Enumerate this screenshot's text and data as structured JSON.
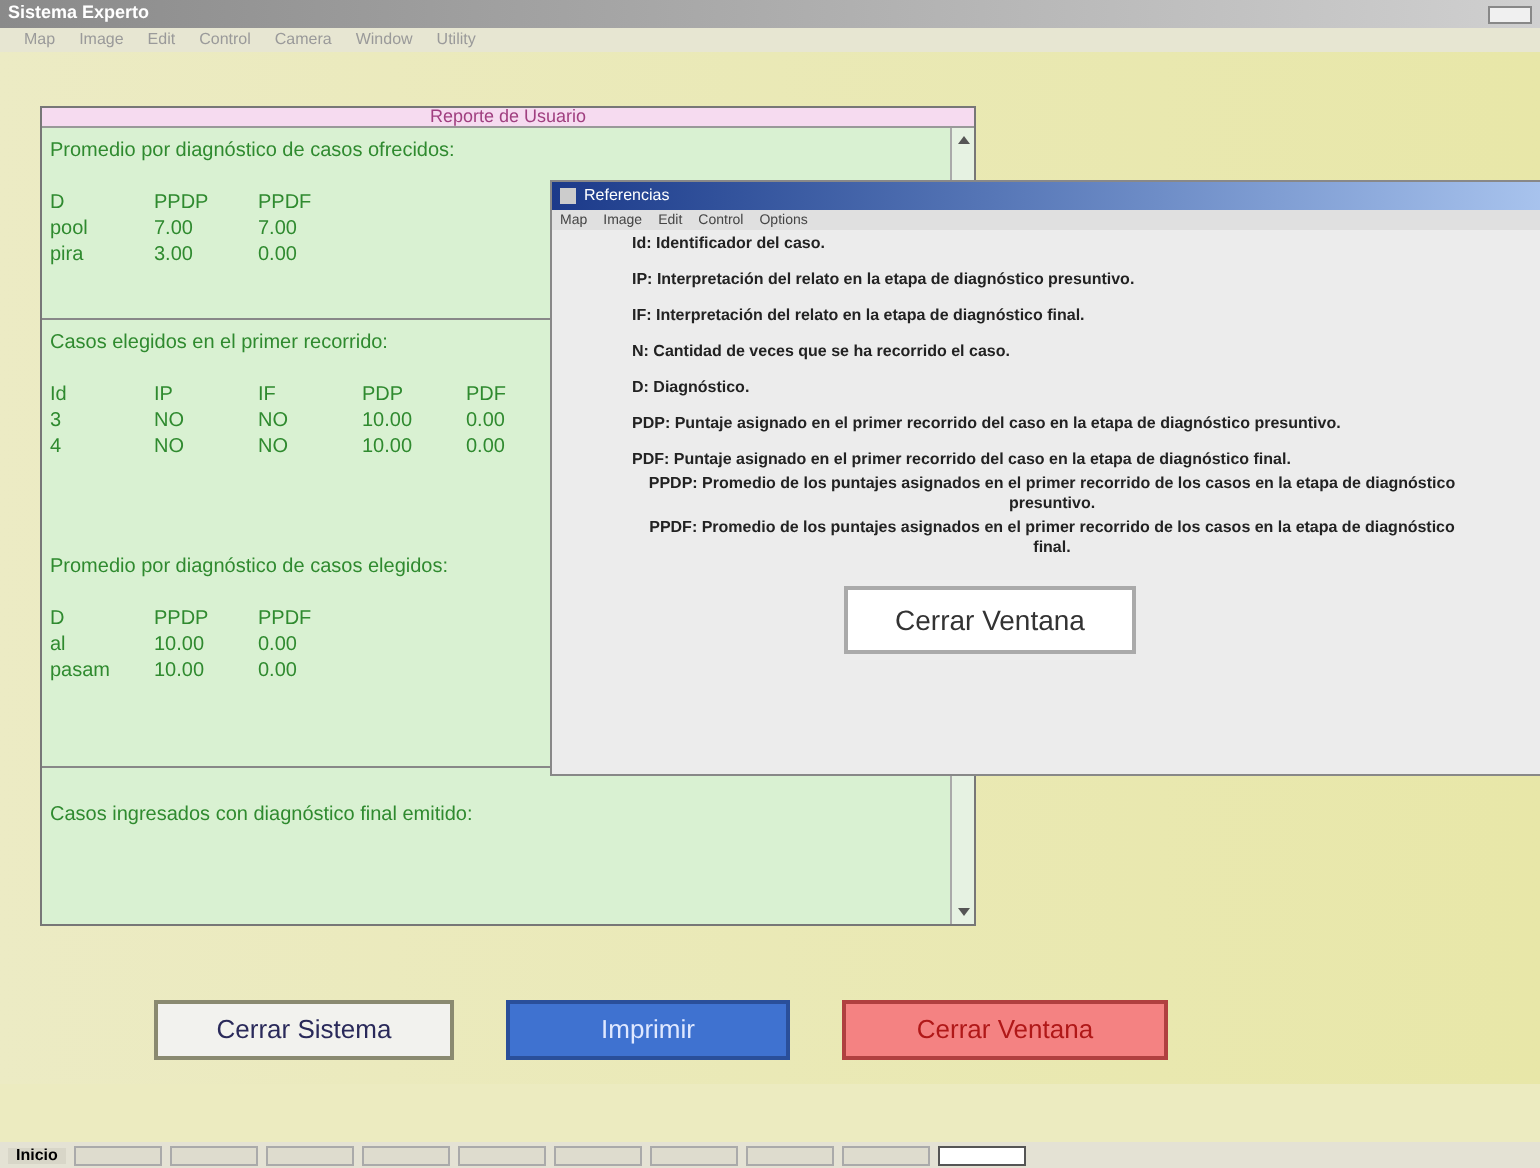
{
  "window": {
    "title": "Sistema Experto",
    "menu": [
      "Map",
      "Image",
      "Edit",
      "Control",
      "Camera",
      "Window",
      "Utility"
    ]
  },
  "report": {
    "title": "Reporte de Usuario",
    "sections": [
      {
        "heading": "Promedio por diagnóstico de casos ofrecidos:",
        "columns": [
          "D",
          "PPDP",
          "PPDF"
        ],
        "rows": [
          [
            "pool",
            "7.00",
            "7.00"
          ],
          [
            "pira",
            "3.00",
            "0.00"
          ]
        ]
      },
      {
        "heading": "Casos elegidos en el primer recorrido:",
        "columns": [
          "Id",
          "IP",
          "IF",
          "PDP",
          "PDF"
        ],
        "rows": [
          [
            "3",
            "NO",
            "NO",
            "10.00",
            "0.00"
          ],
          [
            "4",
            "NO",
            "NO",
            "10.00",
            "0.00"
          ]
        ]
      },
      {
        "heading": "Promedio por diagnóstico de casos elegidos:",
        "columns": [
          "D",
          "PPDP",
          "PPDF"
        ],
        "rows": [
          [
            "al",
            "10.00",
            "0.00"
          ],
          [
            "pasam",
            "10.00",
            "0.00"
          ]
        ]
      },
      {
        "heading": "Casos ingresados con diagnóstico final emitido:"
      }
    ]
  },
  "dialog": {
    "title": "Referencias",
    "menu": [
      "Map",
      "Image",
      "Edit",
      "Control",
      "Options"
    ],
    "items": [
      {
        "text": "Id: Identificador del caso.",
        "kind": "line"
      },
      {
        "text": "IP: Interpretación del relato en la etapa de diagnóstico presuntivo.",
        "kind": "line"
      },
      {
        "text": "IF: Interpretación del relato en la etapa de diagnóstico final.",
        "kind": "line"
      },
      {
        "text": "N: Cantidad de veces que se ha recorrido el caso.",
        "kind": "line"
      },
      {
        "text": "D: Diagnóstico.",
        "kind": "line"
      },
      {
        "text": "PDP: Puntaje asignado en el primer recorrido del caso en la etapa de diagnóstico presuntivo.",
        "kind": "line"
      },
      {
        "text": "PDF: Puntaje asignado en el primer recorrido del caso en la etapa de diagnóstico final.",
        "kind": "line"
      },
      {
        "text": "PPDP: Promedio de los puntajes asignados en el primer recorrido de los casos en la etapa de diagnóstico presuntivo.",
        "kind": "wrapped"
      },
      {
        "text": "PPDF: Promedio de los puntajes asignados en el primer recorrido de los casos en la etapa de diagnóstico final.",
        "kind": "wrapped"
      }
    ],
    "button": "Cerrar Ventana"
  },
  "buttons": [
    {
      "label": "Cerrar Sistema",
      "kind": "plain"
    },
    {
      "label": "Imprimir",
      "kind": "primary"
    },
    {
      "label": "Cerrar Ventana",
      "kind": "danger"
    }
  ],
  "taskbar": {
    "start": "Inicio",
    "tasks": [
      {
        "selected": false
      },
      {
        "selected": false
      },
      {
        "selected": false
      },
      {
        "selected": false
      },
      {
        "selected": false
      },
      {
        "selected": false
      },
      {
        "selected": false
      },
      {
        "selected": false
      },
      {
        "selected": false
      },
      {
        "selected": true
      }
    ]
  }
}
